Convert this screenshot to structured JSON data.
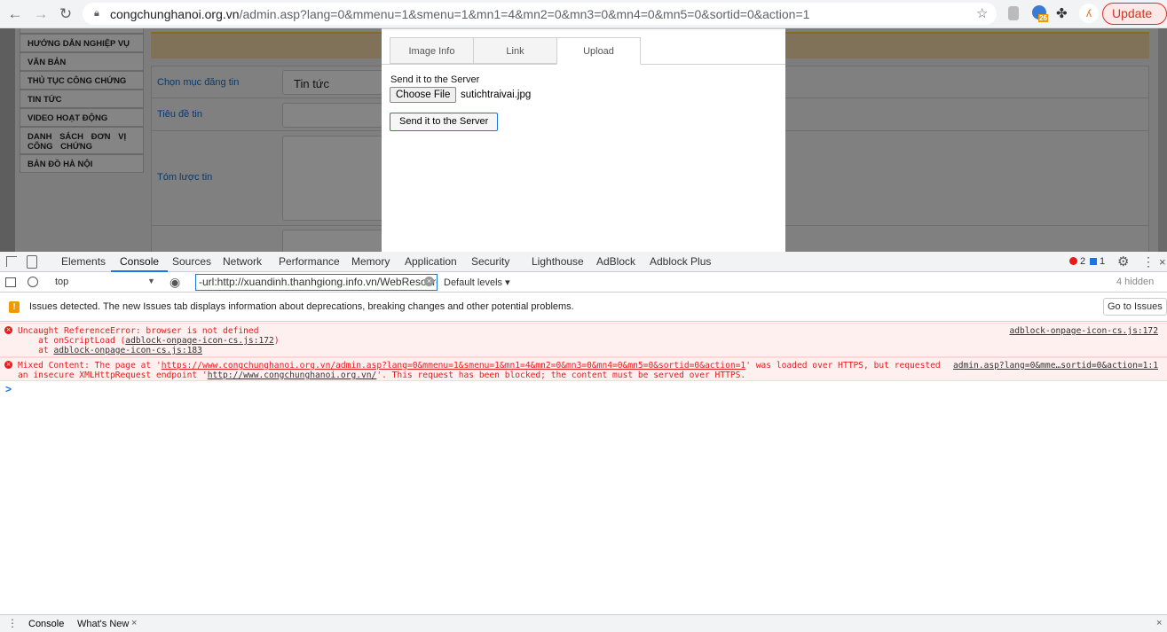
{
  "browser": {
    "url_host": "congchunghanoi.org.vn",
    "url_path": "/admin.asp?lang=0&mmenu=1&smenu=1&mn1=4&mn2=0&mn3=0&mn4=0&mn5=0&sortid=0&action=1",
    "update_label": "Update",
    "extension_badge": "26"
  },
  "sidebar": {
    "items": [
      "HƯỚNG DẪN NGHIỆP VỤ",
      "VĂN BẢN",
      "THỦ TỤC CÔNG CHỨNG",
      "TIN TỨC",
      "VIDEO HOẠT ĐỘNG",
      "DANH SÁCH ĐƠN VỊ CÔNG CHỨNG",
      "BẢN ĐỒ HÀ NỘI"
    ]
  },
  "form": {
    "category_label": "Chọn mục đăng tin",
    "category_value": "Tin tức",
    "title_label": "Tiêu đề tin",
    "summary_label": "Tóm lược tin"
  },
  "dialog": {
    "tabs": [
      "Image Info",
      "Link",
      "Upload"
    ],
    "active_tab": "Upload",
    "upload_label": "Send it to the Server",
    "choose_file": "Choose File",
    "file_name": "sutichtraivai.jpg",
    "send_button": "Send it to the Server"
  },
  "devtools": {
    "tabs": [
      "Elements",
      "Console",
      "Sources",
      "Network",
      "Performance",
      "Memory",
      "Application",
      "Security",
      "Lighthouse",
      "AdBlock",
      "Adblock Plus"
    ],
    "active_tab": "Console",
    "error_count": "2",
    "info_count": "1",
    "context": "top",
    "filter_value": "-url:http://xuandinh.thanhgiong.info.vn/WebResource",
    "levels": "Default levels",
    "hidden": "4 hidden",
    "issues_text": "Issues detected. The new Issues tab displays information about deprecations, breaking changes and other potential problems.",
    "go_to_issues": "Go to Issues",
    "messages": [
      {
        "line1": "Uncaught ReferenceError: browser is not defined",
        "line2_prefix": "    at onScriptLoad (",
        "line2_link": "adblock-onpage-icon-cs.js:172",
        "line2_suffix": ")",
        "line3_prefix": "    at ",
        "line3_link": "adblock-onpage-icon-cs.js:183",
        "source": "adblock-onpage-icon-cs.js:172"
      },
      {
        "line1_prefix": "Mixed Content: The page at '",
        "line1_link": "https://www.congchunghanoi.org.vn/admin.asp?lang=0&mmenu=1&smenu=1&mn1=4&mn2=0&mn3=0&mn4=0&mn5=0&sortid=0&action=1",
        "line1_suffix": "' was loaded over HTTPS, but requested",
        "line2_prefix": "an insecure XMLHttpRequest endpoint '",
        "line2_link": "http://www.congchunghanoi.org.vn/",
        "line2_suffix": "'. This request has been blocked; the content must be served over HTTPS.",
        "source": "admin.asp?lang=0&mme…sortid=0&action=1:1"
      }
    ],
    "prompt": ">",
    "drawer_tabs": [
      "Console",
      "What's New"
    ]
  }
}
